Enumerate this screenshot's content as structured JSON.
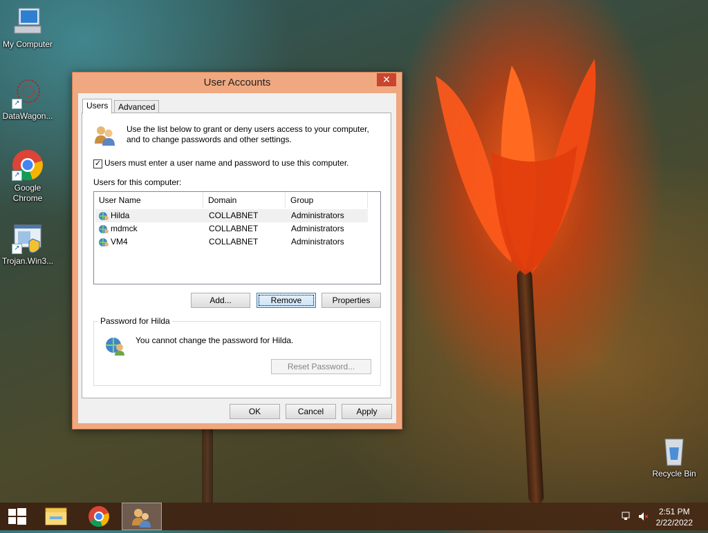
{
  "desktop": {
    "icons": [
      {
        "label": "My Computer"
      },
      {
        "label": "DataWagon..."
      },
      {
        "label": "Google Chrome"
      },
      {
        "label": "Trojan.Win3..."
      },
      {
        "label": "Recycle Bin"
      }
    ]
  },
  "window": {
    "title": "User Accounts",
    "close_glyph": "✕",
    "tabs": [
      {
        "label": "Users",
        "active": true
      },
      {
        "label": "Advanced",
        "active": false
      }
    ],
    "intro_text": "Use the list below to grant or deny users access to your computer, and to change passwords and other settings.",
    "require_login": {
      "checked": true,
      "label": "Users must enter a user name and password to use this computer."
    },
    "users_caption": "Users for this computer:",
    "columns": [
      "User Name",
      "Domain",
      "Group"
    ],
    "users": [
      {
        "name": "Hilda",
        "domain": "COLLABNET",
        "group": "Administrators",
        "selected": true
      },
      {
        "name": "mdmck",
        "domain": "COLLABNET",
        "group": "Administrators",
        "selected": false
      },
      {
        "name": "VM4",
        "domain": "COLLABNET",
        "group": "Administrators",
        "selected": false
      }
    ],
    "buttons": {
      "add": "Add...",
      "remove": "Remove",
      "properties": "Properties",
      "reset_password": "Reset Password...",
      "ok": "OK",
      "cancel": "Cancel",
      "apply": "Apply"
    },
    "password_group": {
      "title": "Password for Hilda",
      "message": "You cannot change the password for Hilda."
    }
  },
  "taskbar": {
    "time": "2:51 PM",
    "date": "2/22/2022"
  },
  "colors": {
    "window_frame": "#f0a880",
    "close_button": "#c9452e",
    "selection": "#f0f0f0",
    "focus_button": "#cce4f7"
  }
}
